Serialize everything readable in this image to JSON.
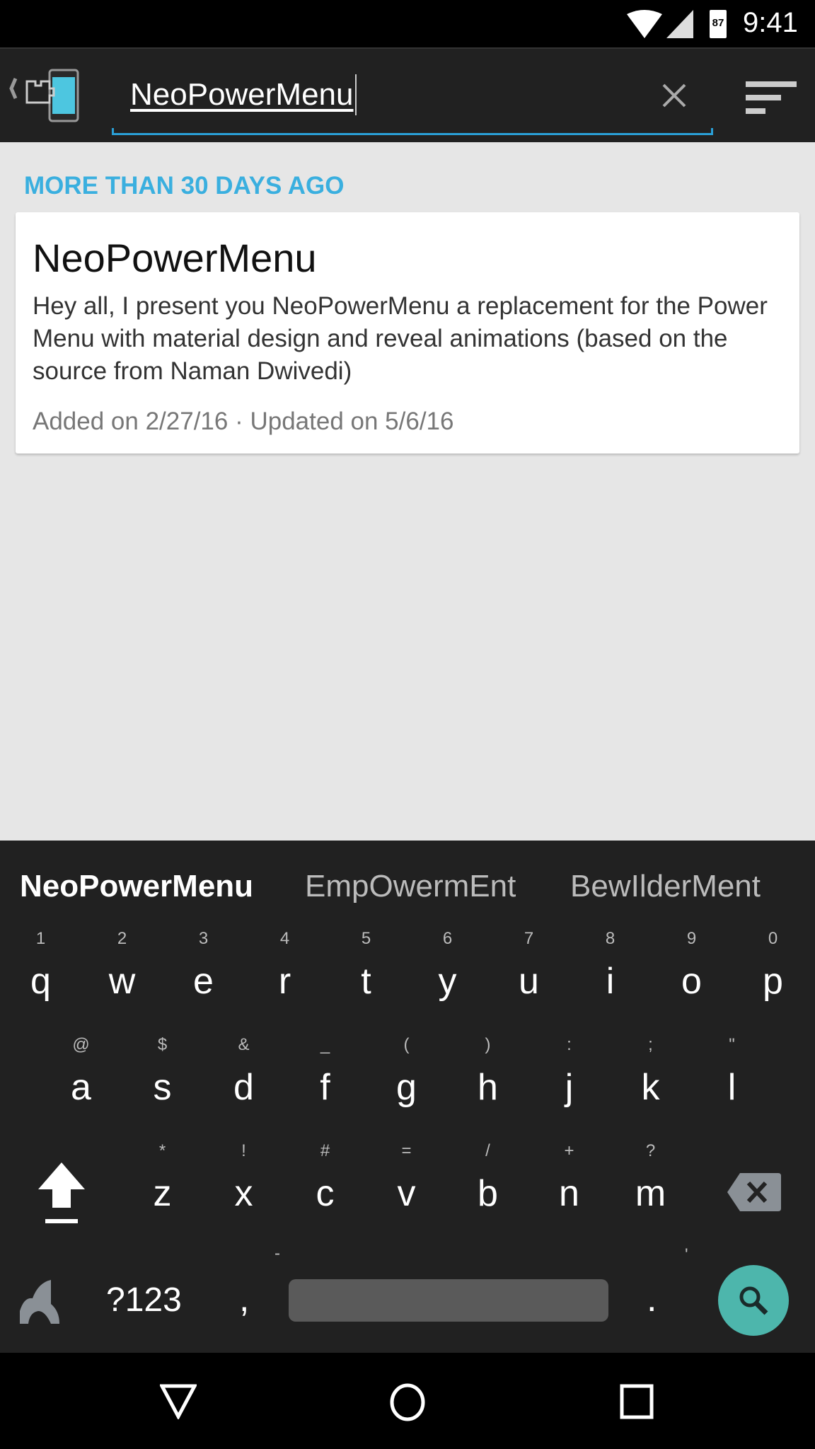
{
  "status_bar": {
    "battery": "87",
    "time": "9:41"
  },
  "toolbar": {
    "search_value": "NeoPowerMenu"
  },
  "content": {
    "section_header": "MORE THAN 30 DAYS AGO",
    "card": {
      "title": "NeoPowerMenu",
      "description": "Hey all, I present you NeoPowerMenu a replacement for the Power Menu with material design and reveal animations (based on the source from Naman Dwivedi)",
      "meta": "Added on 2/27/16 · Updated on 5/6/16"
    }
  },
  "keyboard": {
    "suggestions": [
      "NeoPowerMenu",
      "EmpOwermEnt",
      "BewIlderMent"
    ],
    "row1": [
      {
        "k": "q",
        "h": "1"
      },
      {
        "k": "w",
        "h": "2"
      },
      {
        "k": "e",
        "h": "3"
      },
      {
        "k": "r",
        "h": "4"
      },
      {
        "k": "t",
        "h": "5"
      },
      {
        "k": "y",
        "h": "6"
      },
      {
        "k": "u",
        "h": "7"
      },
      {
        "k": "i",
        "h": "8"
      },
      {
        "k": "o",
        "h": "9"
      },
      {
        "k": "p",
        "h": "0"
      }
    ],
    "row2": [
      {
        "k": "a",
        "h": "@"
      },
      {
        "k": "s",
        "h": "$"
      },
      {
        "k": "d",
        "h": "&"
      },
      {
        "k": "f",
        "h": "_"
      },
      {
        "k": "g",
        "h": "("
      },
      {
        "k": "h",
        "h": ")"
      },
      {
        "k": "j",
        "h": ":"
      },
      {
        "k": "k",
        "h": ";"
      },
      {
        "k": "l",
        "h": "\""
      }
    ],
    "row3": [
      {
        "k": "z",
        "h": "*"
      },
      {
        "k": "x",
        "h": "!"
      },
      {
        "k": "c",
        "h": "#"
      },
      {
        "k": "v",
        "h": "="
      },
      {
        "k": "b",
        "h": "/"
      },
      {
        "k": "n",
        "h": "+"
      },
      {
        "k": "m",
        "h": "?"
      }
    ],
    "symbols_label": "?123",
    "comma": ",",
    "comma_hint": "-",
    "period": ".",
    "period_hint": "'",
    "accent_color": "#4db6ac"
  }
}
